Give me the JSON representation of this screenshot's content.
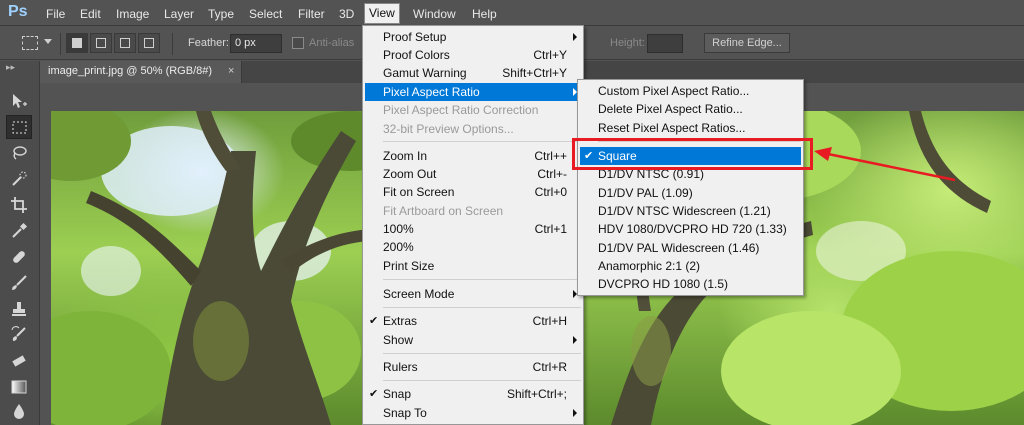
{
  "app": {
    "logo": "Ps"
  },
  "menubar": {
    "items": [
      "File",
      "Edit",
      "Image",
      "Layer",
      "Type",
      "Select",
      "Filter",
      "3D",
      "View",
      "Window",
      "Help"
    ],
    "active": "View"
  },
  "options": {
    "feather_label": "Feather:",
    "feather_value": "0 px",
    "antialias_label": "Anti-alias",
    "height_label": "Height:",
    "refine_edge_label": "Refine Edge..."
  },
  "document": {
    "tab_title": "image_print.jpg @ 50% (RGB/8#)",
    "close_glyph": "×"
  },
  "view_menu": {
    "items": [
      {
        "label": "Proof Setup",
        "shortcut": "",
        "submenu": true
      },
      {
        "label": "Proof Colors",
        "shortcut": "Ctrl+Y"
      },
      {
        "label": "Gamut Warning",
        "shortcut": "Shift+Ctrl+Y"
      },
      {
        "label": "Pixel Aspect Ratio",
        "shortcut": "",
        "submenu": true,
        "highlight": true
      },
      {
        "label": "Pixel Aspect Ratio Correction",
        "shortcut": "",
        "disabled": true
      },
      {
        "label": "32-bit Preview Options...",
        "shortcut": "",
        "disabled": true
      },
      {
        "label": "Zoom In",
        "shortcut": "Ctrl++"
      },
      {
        "label": "Zoom Out",
        "shortcut": "Ctrl+-"
      },
      {
        "label": "Fit on Screen",
        "shortcut": "Ctrl+0"
      },
      {
        "label": "Fit Artboard on Screen",
        "shortcut": "",
        "disabled": true
      },
      {
        "label": "100%",
        "shortcut": "Ctrl+1"
      },
      {
        "label": "200%",
        "shortcut": ""
      },
      {
        "label": "Print Size",
        "shortcut": ""
      },
      {
        "label": "Screen Mode",
        "shortcut": "",
        "submenu": true
      },
      {
        "label": "Extras",
        "shortcut": "Ctrl+H",
        "checked": true
      },
      {
        "label": "Show",
        "shortcut": "",
        "submenu": true
      },
      {
        "label": "Rulers",
        "shortcut": "Ctrl+R"
      },
      {
        "label": "Snap",
        "shortcut": "Shift+Ctrl+;",
        "checked": true
      },
      {
        "label": "Snap To",
        "shortcut": "",
        "submenu": true
      }
    ]
  },
  "par_submenu": {
    "items": [
      {
        "label": "Custom Pixel Aspect Ratio..."
      },
      {
        "label": "Delete Pixel Aspect Ratio..."
      },
      {
        "label": "Reset Pixel Aspect Ratios..."
      },
      {
        "label": "Square",
        "checked": true,
        "highlight": true
      },
      {
        "label": "D1/DV NTSC (0.91)"
      },
      {
        "label": "D1/DV PAL (1.09)"
      },
      {
        "label": "D1/DV NTSC Widescreen (1.21)"
      },
      {
        "label": "HDV 1080/DVCPRO HD 720 (1.33)"
      },
      {
        "label": "D1/DV PAL Widescreen (1.46)"
      },
      {
        "label": "Anamorphic 2:1 (2)"
      },
      {
        "label": "DVCPRO HD 1080 (1.5)"
      }
    ]
  },
  "glyphs": {
    "check": "✔"
  },
  "colors": {
    "highlight": "#0078d7",
    "annotation": "#e81b23"
  },
  "tools": [
    "move-tool-icon",
    "marquee-tool-icon",
    "lasso-tool-icon",
    "quick-select-tool-icon",
    "crop-tool-icon",
    "eyedropper-tool-icon",
    "healing-brush-tool-icon",
    "brush-tool-icon",
    "clone-stamp-tool-icon",
    "history-brush-tool-icon",
    "eraser-tool-icon",
    "gradient-tool-icon",
    "blur-tool-icon"
  ]
}
